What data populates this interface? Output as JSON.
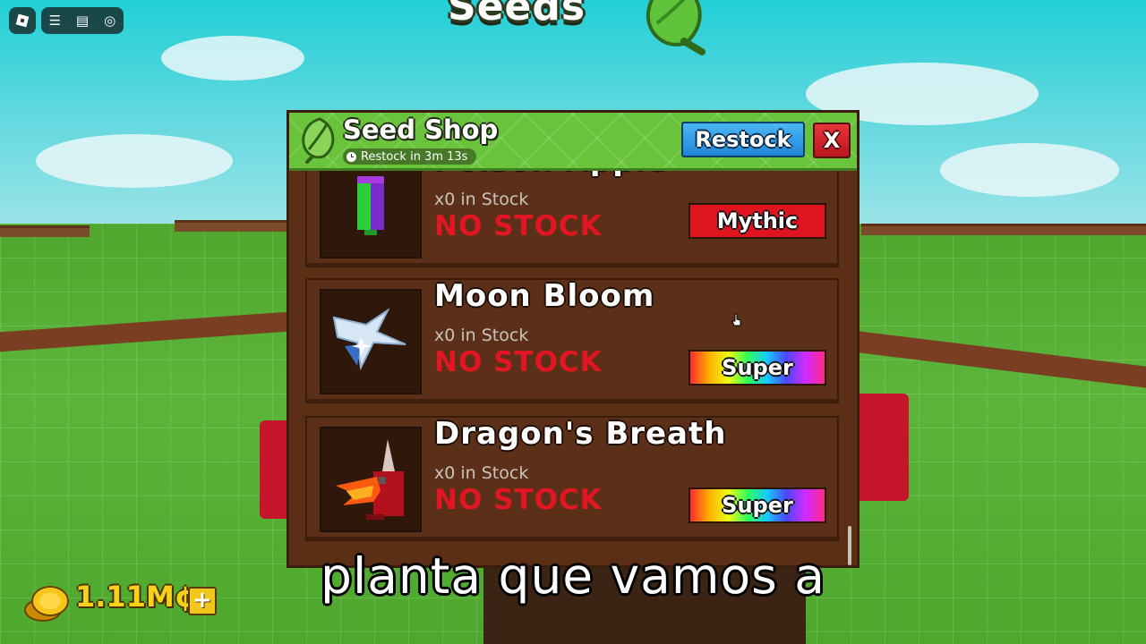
{
  "roblox_bar": {
    "logo_icon": "roblox-logo-icon",
    "buttons": [
      {
        "icon": "menu-icon",
        "glyph": "☰"
      },
      {
        "icon": "chat-icon",
        "glyph": "▤"
      },
      {
        "icon": "headset-icon",
        "glyph": "◎"
      }
    ]
  },
  "background": {
    "seeds_sign": "Seeds"
  },
  "shop": {
    "title": "Seed Shop",
    "restock_timer": "Restock in 3m 13s",
    "restock_button": "Restock",
    "close_button": "X",
    "items": [
      {
        "name": "Poison Apple",
        "stock": "x0 in Stock",
        "status": "NO STOCK",
        "rarity": "Mythic",
        "rarity_color": "#e0141e"
      },
      {
        "name": "Moon Bloom",
        "stock": "x0 in Stock",
        "status": "NO STOCK",
        "rarity": "Super",
        "rarity_color": "rainbow"
      },
      {
        "name": "Dragon's Breath",
        "stock": "x0 in Stock",
        "status": "NO STOCK",
        "rarity": "Super",
        "rarity_color": "rainbow"
      }
    ]
  },
  "currency": {
    "amount": "1.11M¢",
    "add_button": "+"
  },
  "subtitle": "planta que vamos a",
  "colors": {
    "header_green": "#69c43b",
    "panel_brown": "#5a2f16",
    "no_stock_red": "#e01623",
    "currency_gold": "#f6d21b",
    "restock_blue": "#1f86d6"
  }
}
